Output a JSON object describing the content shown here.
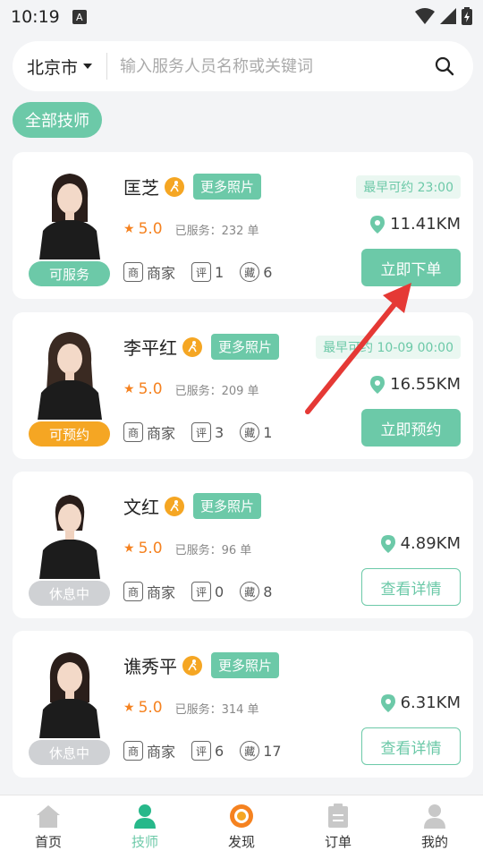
{
  "status_bar": {
    "time": "10:19",
    "notif_glyph": "A"
  },
  "search": {
    "city": "北京市",
    "placeholder": "输入服务人员名称或关键词"
  },
  "filter": {
    "label": "全部技师"
  },
  "technicians": [
    {
      "name": "匡芝",
      "more_photos": "更多照片",
      "earliest": "最早可约 23:00",
      "rating": "5.0",
      "served": "已服务：232 单",
      "distance": "11.41KM",
      "status": "可服务",
      "status_color": "#6cc9a8",
      "merchant": "商家",
      "merchant_icon": "商",
      "reviews_icon": "评",
      "reviews": "1",
      "favorites_icon": "藏",
      "favorites": "6",
      "action": "立即下单"
    },
    {
      "name": "李平红",
      "more_photos": "更多照片",
      "earliest": "最早可约 10-09 00:00",
      "rating": "5.0",
      "served": "已服务：209 单",
      "distance": "16.55KM",
      "status": "可预约",
      "status_color": "#f5a623",
      "merchant": "商家",
      "merchant_icon": "商",
      "reviews_icon": "评",
      "reviews": "3",
      "favorites_icon": "藏",
      "favorites": "1",
      "action": "立即预约"
    },
    {
      "name": "文红",
      "more_photos": "更多照片",
      "earliest": "",
      "rating": "5.0",
      "served": "已服务：96 单",
      "distance": "4.89KM",
      "status": "休息中",
      "status_color": "#cfd1d4",
      "merchant": "商家",
      "merchant_icon": "商",
      "reviews_icon": "评",
      "reviews": "0",
      "favorites_icon": "藏",
      "favorites": "8",
      "action": "查看详情"
    },
    {
      "name": "谯秀平",
      "more_photos": "更多照片",
      "earliest": "",
      "rating": "5.0",
      "served": "已服务：314 单",
      "distance": "6.31KM",
      "status": "休息中",
      "status_color": "#cfd1d4",
      "merchant": "商家",
      "merchant_icon": "商",
      "reviews_icon": "评",
      "reviews": "6",
      "favorites_icon": "藏",
      "favorites": "17",
      "action": "查看详情"
    }
  ],
  "tabs": [
    {
      "label": "首页",
      "icon": "home-icon"
    },
    {
      "label": "技师",
      "icon": "technician-icon"
    },
    {
      "label": "发现",
      "icon": "discover-icon"
    },
    {
      "label": "订单",
      "icon": "orders-icon"
    },
    {
      "label": "我的",
      "icon": "profile-icon"
    }
  ],
  "colors": {
    "accent": "#6cc9a8",
    "orange": "#f5a623",
    "rating": "#f58220",
    "annotation_arrow": "#e53935"
  }
}
